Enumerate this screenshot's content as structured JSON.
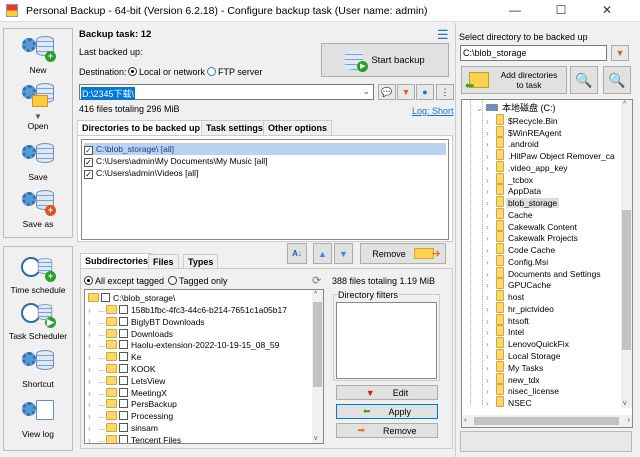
{
  "window": {
    "title": "Personal Backup - 64-bit (Version 6.2.18) - Configure backup task (User name: admin)",
    "minimize": "—",
    "maximize": "☐",
    "close": "✕"
  },
  "toolbar": {
    "group1": [
      {
        "label": "New",
        "icon": "new-task-icon"
      },
      {
        "label": "Open",
        "icon": "open-task-icon"
      },
      {
        "label": "Save",
        "icon": "save-icon"
      },
      {
        "label": "Save as",
        "icon": "save-as-icon"
      }
    ],
    "group2": [
      {
        "label": "Time schedule",
        "icon": "time-schedule-icon"
      },
      {
        "label": "Task Scheduler",
        "icon": "task-scheduler-icon"
      },
      {
        "label": "Shortcut",
        "icon": "shortcut-icon"
      },
      {
        "label": "View log",
        "icon": "view-log-icon"
      }
    ]
  },
  "task": {
    "title": "Backup task: 12",
    "last_backed_up": "Last backed up:",
    "destination_label": "Destination:",
    "dest_local": "Local or network",
    "dest_ftp": "FTP server",
    "dest_path": "D:\\2345下载\\",
    "files_summary": "416 files totaling 296 MiB",
    "log_link": "Log: Short",
    "start_backup": "Start backup"
  },
  "tabs": [
    "Directories to be backed up",
    "Task settings",
    "Other options"
  ],
  "directories": [
    "C:\\blob_storage\\ [all]",
    "C:\\Users\\admin\\My Documents\\My Music [all]",
    "C:\\Users\\admin\\Videos [all]"
  ],
  "dir_actions": {
    "remove": "Remove"
  },
  "subtabs": [
    "Subdirectories",
    "Files",
    "Types"
  ],
  "filter": {
    "all_except": "All except tagged",
    "tagged_only": "Tagged only",
    "summary": "388 files totaling 1.19 MiB"
  },
  "subdir_tree": {
    "root": "C:\\blob_storage\\",
    "items": [
      "158b1fbc-4fc3-44c6-b214-7651c1a05b17",
      "BiglyBT Downloads",
      "Downloads",
      "Haolu-extension-2022-10-19-15_08_59",
      "Ke",
      "KOOK",
      "LetsView",
      "MeetingX",
      "PersBackup",
      "Processing",
      "sinsam",
      "Tencent Files"
    ]
  },
  "directory_filters": {
    "title": "Directory filters",
    "edit": "Edit",
    "apply": "Apply",
    "remove": "Remove"
  },
  "right": {
    "label": "Select directory to be backed up",
    "path": "C:\\blob_storage",
    "add_button": "Add directories to task",
    "drive": "本地磁盘 (C:)",
    "selected": "blob_storage",
    "items": [
      "$Recycle.Bin",
      "$WinREAgent",
      ".android",
      ".HitPaw Object Remover_ca",
      ".video_app_key",
      "_tcbox",
      "AppData",
      "blob_storage",
      "Cache",
      "Cakewalk Content",
      "Cakewalk Projects",
      "Code Cache",
      "Config.Msi",
      "Documents and Settings",
      "GPUCache",
      "host",
      "hr_pictvideo",
      "htsoft",
      "Intel",
      "LenovoQuickFix",
      "Local Storage",
      "My Tasks",
      "new_tdx",
      "nisec_license",
      "NSEC"
    ]
  },
  "colors": {
    "accent": "#0078d7",
    "selection": "#b9d3ee",
    "arrow": "#e02020"
  }
}
